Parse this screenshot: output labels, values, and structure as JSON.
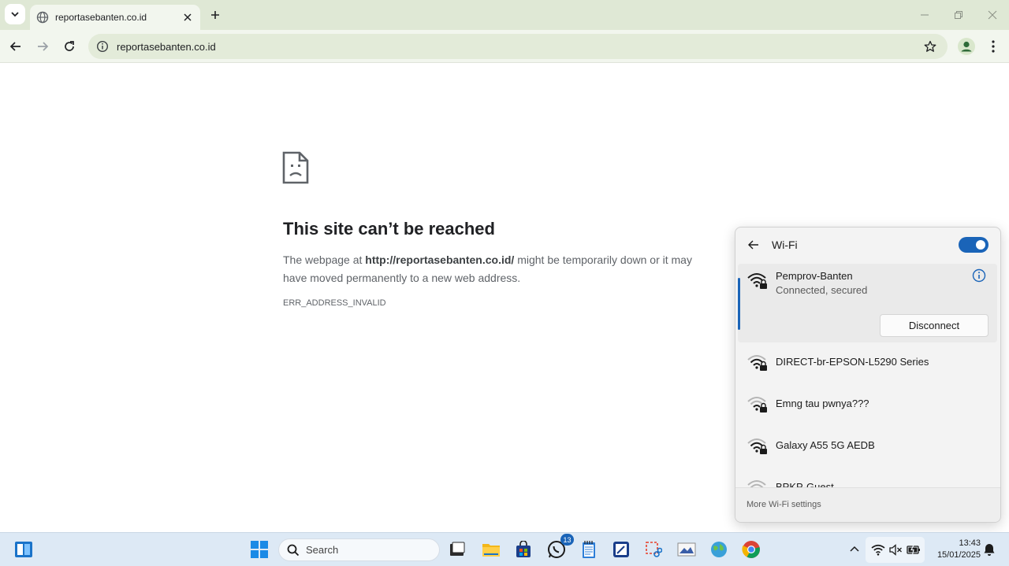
{
  "browser": {
    "tab_title": "reportasebanten.co.id",
    "url": "reportasebanten.co.id"
  },
  "error_page": {
    "heading": "This site can’t be reached",
    "body_prefix": "The webpage at ",
    "body_url": "http://reportasebanten.co.id/",
    "body_suffix": " might be temporarily down or it may have moved permanently to a new web address.",
    "error_code": "ERR_ADDRESS_INVALID"
  },
  "wifi_panel": {
    "title": "Wi-Fi",
    "toggle_on": true,
    "connected_network": {
      "name": "Pemprov-Banten",
      "status": "Connected, secured",
      "disconnect_label": "Disconnect"
    },
    "networks": [
      {
        "name": "DIRECT-br-EPSON-L5290 Series"
      },
      {
        "name": "Emng tau pwnya???"
      },
      {
        "name": "Galaxy A55 5G AEDB"
      },
      {
        "name": "BPKP-Guest"
      }
    ],
    "more_settings": "More Wi-Fi settings"
  },
  "taskbar": {
    "search_placeholder": "Search",
    "whatsapp_badge": "13",
    "time": "13:43",
    "date": "15/01/2025"
  },
  "colors": {
    "accent": "#1a64b8",
    "chrome_bg": "#dfe8d5",
    "toolbar_bg": "#f2f6ee"
  }
}
